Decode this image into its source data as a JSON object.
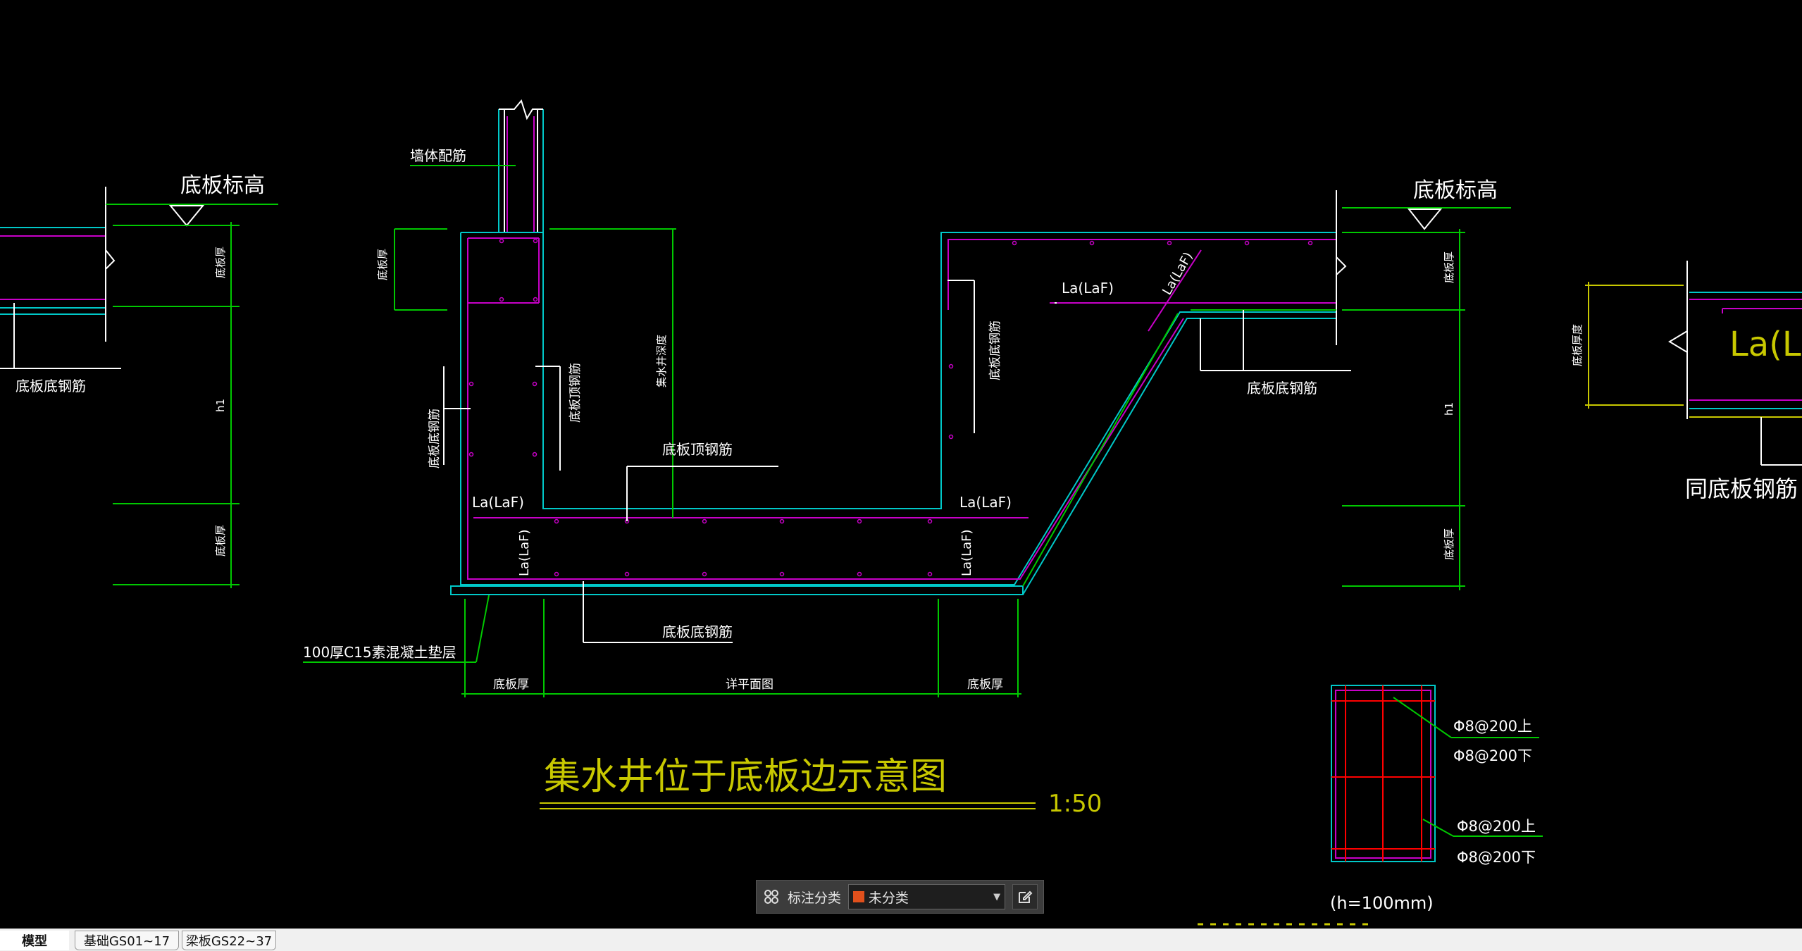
{
  "drawing": {
    "title": "集水井位于底板边示意图",
    "scale": "1:50",
    "labels": {
      "slab_elev_left": "底板标高",
      "slab_elev_right": "底板标高",
      "left_bottom_rebar": "底板底钢筋",
      "wall_rebar": "墙体配筋",
      "slab_thick_v": "底板厚",
      "pit_depth": "集水井深度",
      "pit_bottom_rebar_v": "底板底钢筋",
      "pit_top_rebar_v": "底板顶钢筋",
      "slab_top_rebar": "底板顶钢筋",
      "la_left": "La(LaF)",
      "la_right": "La(LaF)",
      "la_vert_left": "La(LaF)",
      "la_vert_right": "La(LaF)",
      "la_slope": "La(LaF)",
      "la_upper": "La(LaF)",
      "slab_bottom_rebar_center": "底板底钢筋",
      "cushion": "100厚C15素混凝土垫层",
      "dim_left": "底板厚",
      "dim_mid": "详平面图",
      "dim_right": "底板厚",
      "right_slab_bottom": "底板底钢筋",
      "right_v_rebar": "底板底钢筋",
      "dim_h1_left": "h1",
      "dim_h1_right": "h1",
      "dim_slab_left_top": "底板厚",
      "dim_slab_left_bot": "底板厚",
      "dim_slab_right_top": "底板厚",
      "dim_slab_right_bot": "底板厚",
      "far_right_la": "La(La",
      "far_right_label": "同底板钢筋",
      "far_right_v": "底板厚度",
      "rebar_1": "Φ8@200上",
      "rebar_2": "Φ8@200下",
      "rebar_3": "Φ8@200上",
      "rebar_4": "Φ8@200下",
      "h_note": "(h=100mm)"
    }
  },
  "annotation_bar": {
    "label": "标注分类",
    "selected": "未分类",
    "swatch_color": "#e0501c"
  },
  "tabs": [
    {
      "label": "模型",
      "active": true
    },
    {
      "label": "基础GS01~17",
      "active": false
    },
    {
      "label": "梁板GS22~37",
      "active": false
    }
  ],
  "colors": {
    "background": "#000000",
    "green": "#00c800",
    "cyan": "#00c8c8",
    "magenta": "#c800c8",
    "yellow": "#c8c800",
    "white": "#ffffff"
  }
}
